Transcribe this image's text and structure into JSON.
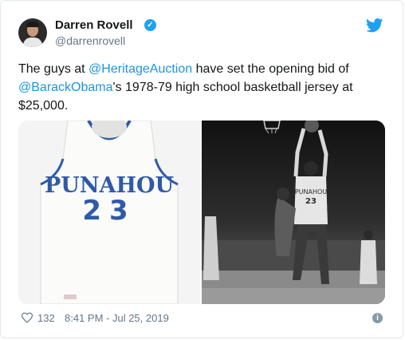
{
  "tweet": {
    "author_name": "Darren Rovell",
    "author_handle": "@darrenrovell",
    "text_before": "The guys at ",
    "mention1": "@HeritageAuction",
    "text_middle": " have set the opening bid of ",
    "mention2": "@BarackObama",
    "text_after": "'s 1978-79 high school basketball jersey at $25,000.",
    "jersey_word": "PUNAHOU",
    "jersey_number": "23",
    "likes": "132",
    "timestamp": "8:41 PM - Jul 25, 2019"
  },
  "colors": {
    "accent": "#1da1f2",
    "link": "#1b95e0",
    "jersey_blue": "#2f5aa8"
  },
  "icons": {
    "verified": "verified-badge-icon",
    "brand": "twitter-bird-icon",
    "like": "heart-icon",
    "info": "info-icon"
  }
}
